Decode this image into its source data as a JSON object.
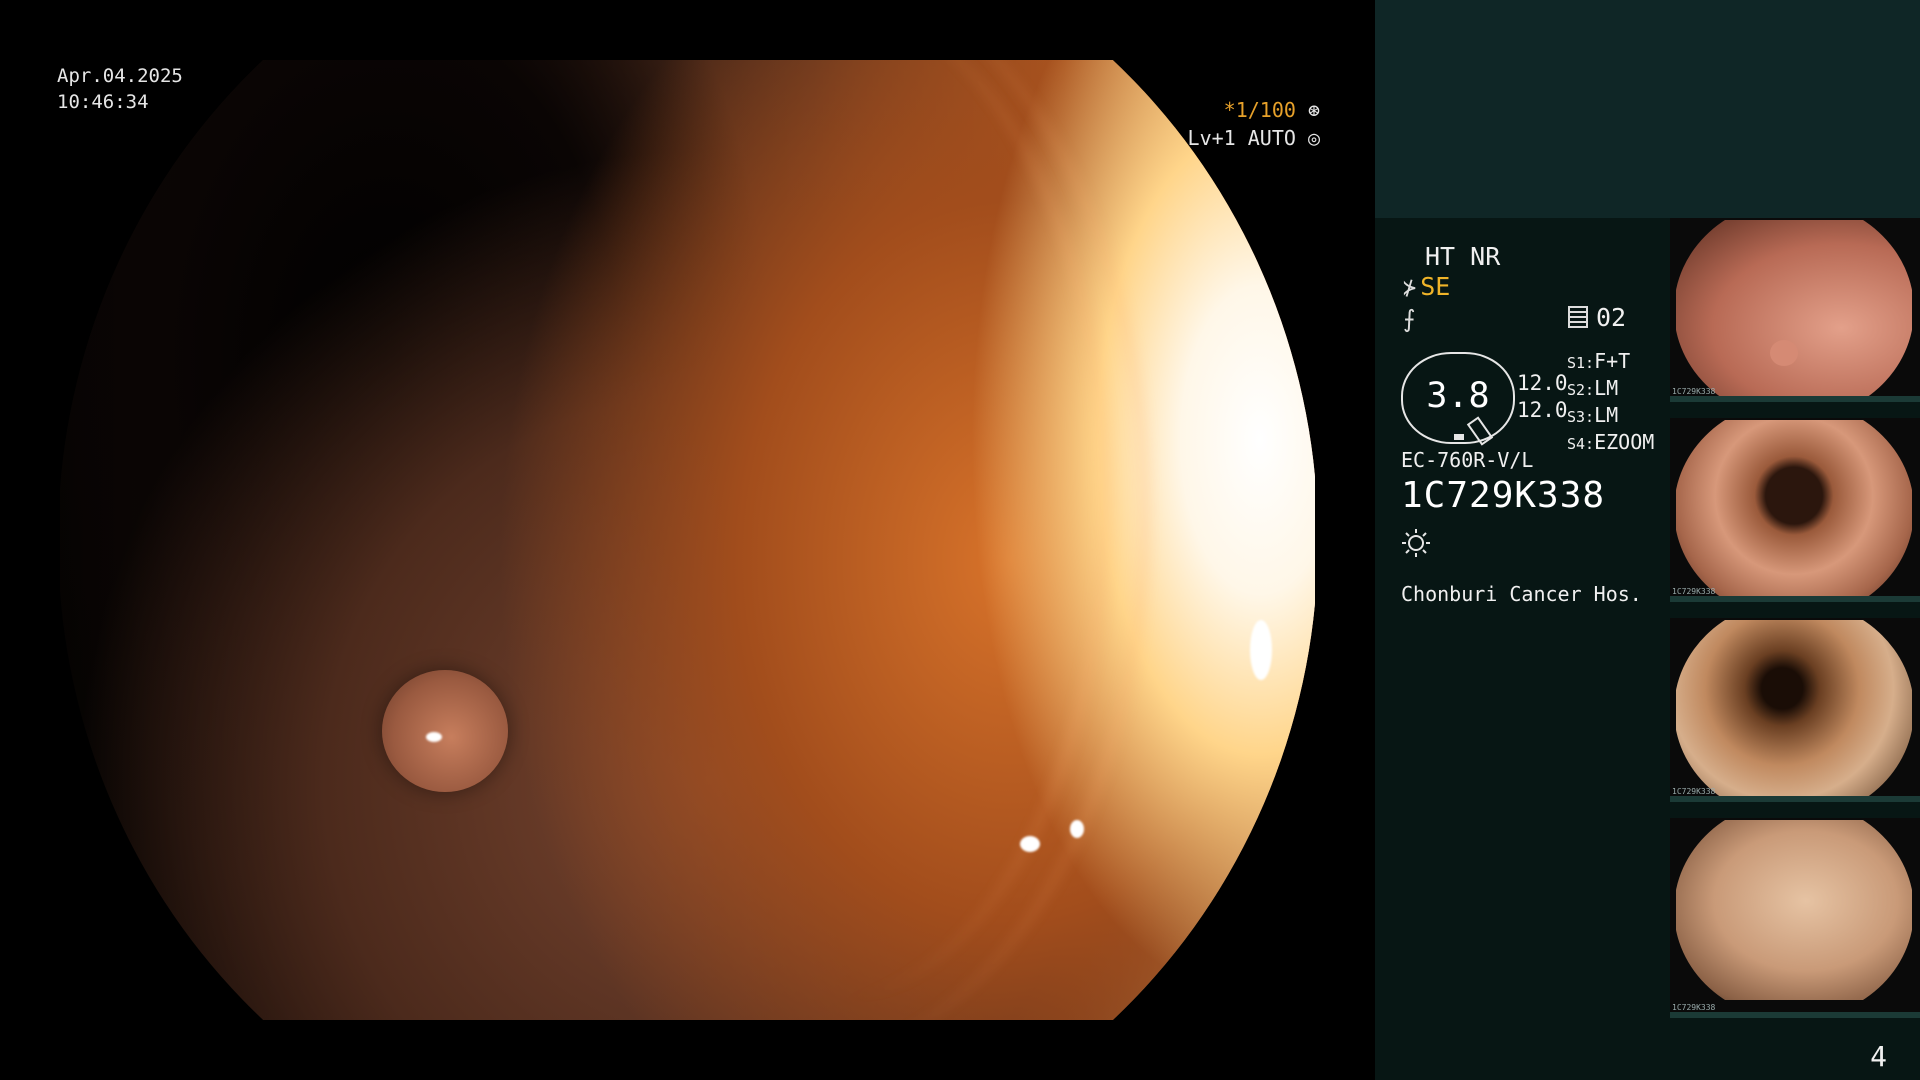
{
  "overlay": {
    "date": "Apr.04.2025",
    "time": "10:46:34",
    "shutter": "*1/100",
    "level": "Lv+1 AUTO"
  },
  "panel": {
    "modes": "HT NR",
    "se": "SE",
    "memory": "02",
    "gauge_value": "3.8",
    "gauge_nums": [
      "12.0",
      "12.0"
    ],
    "switches": [
      {
        "key": "S1:",
        "value": "F+T"
      },
      {
        "key": "S2:",
        "value": "LM"
      },
      {
        "key": "S3:",
        "value": "LM"
      },
      {
        "key": "S4:",
        "value": "EZOOM"
      }
    ],
    "scope_model": "EC-760R-V/L",
    "serial": "1C729K338",
    "hospital": "Chonburi Cancer Hos."
  },
  "thumbnails": [
    {
      "tag": "1C729K338"
    },
    {
      "tag": "1C729K338"
    },
    {
      "tag": "1C729K338"
    },
    {
      "tag": "1C729K338"
    }
  ],
  "page_number": "4",
  "colors": {
    "accent_orange": "#e7a12a",
    "se_yellow": "#f0b429",
    "panel_bg": "#071614",
    "panel_top_bg": "#0f2626"
  }
}
